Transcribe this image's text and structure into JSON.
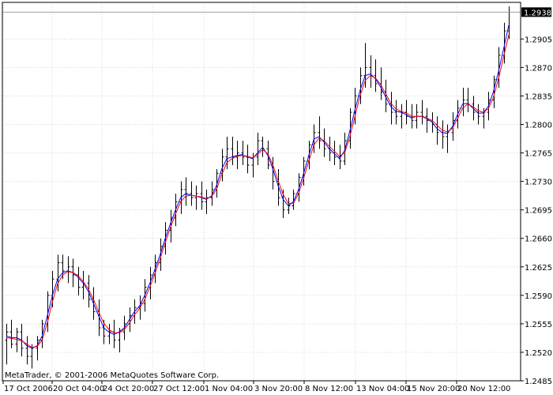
{
  "app": {
    "copyright": "MetaTrader, © 2001-2006 MetaQuotes Software Corp."
  },
  "colors": {
    "background": "#ffffff",
    "grid": "#d8d8d8",
    "frame": "#000000",
    "bars": "#000000",
    "ma_fast": "#ff0000",
    "ma_slow": "#0000ff",
    "price_line": "#a0a0a0"
  },
  "chart_data": {
    "type": "ohlc",
    "title": "",
    "ylim": [
      1.2485,
      1.295
    ],
    "grid": true,
    "y_ticks": [
      "1.2905",
      "1.2870",
      "1.2835",
      "1.2800",
      "1.2765",
      "1.2730",
      "1.2695",
      "1.2660",
      "1.2625",
      "1.2590",
      "1.2555",
      "1.2520",
      "1.2485"
    ],
    "x_ticks": [
      "17 Oct 2006",
      "20 Oct 04:00",
      "24 Oct 20:00",
      "27 Oct 12:00",
      "1 Nov 04:00",
      "3 Nov 20:00",
      "8 Nov 12:00",
      "13 Nov 04:00",
      "15 Nov 20:00",
      "20 Nov 12:00"
    ],
    "current_price": "1.2938",
    "series": [
      {
        "kind": "bars",
        "values": [
          [
            1.2535,
            1.2555,
            1.2505,
            1.2545
          ],
          [
            1.2545,
            1.256,
            1.2525,
            1.253
          ],
          [
            1.253,
            1.255,
            1.252,
            1.2545
          ],
          [
            1.2545,
            1.2555,
            1.2515,
            1.2525
          ],
          [
            1.2525,
            1.254,
            1.2505,
            1.2515
          ],
          [
            1.2515,
            1.253,
            1.25,
            1.2525
          ],
          [
            1.2525,
            1.254,
            1.251,
            1.2535
          ],
          [
            1.2535,
            1.256,
            1.2525,
            1.2555
          ],
          [
            1.2555,
            1.2595,
            1.2545,
            1.259
          ],
          [
            1.259,
            1.262,
            1.2575,
            1.261
          ],
          [
            1.261,
            1.264,
            1.2595,
            1.263
          ],
          [
            1.263,
            1.264,
            1.261,
            1.262
          ],
          [
            1.262,
            1.2638,
            1.2605,
            1.2625
          ],
          [
            1.2625,
            1.2635,
            1.26,
            1.2615
          ],
          [
            1.2615,
            1.2625,
            1.259,
            1.26
          ],
          [
            1.26,
            1.262,
            1.2585,
            1.2605
          ],
          [
            1.2605,
            1.2615,
            1.2575,
            1.2585
          ],
          [
            1.2585,
            1.26,
            1.256,
            1.257
          ],
          [
            1.257,
            1.2585,
            1.254,
            1.255
          ],
          [
            1.255,
            1.256,
            1.253,
            1.254
          ],
          [
            1.254,
            1.2555,
            1.253,
            1.2545
          ],
          [
            1.2545,
            1.256,
            1.2525,
            1.2535
          ],
          [
            1.2535,
            1.255,
            1.252,
            1.2545
          ],
          [
            1.2545,
            1.2565,
            1.2535,
            1.2555
          ],
          [
            1.2555,
            1.2575,
            1.2545,
            1.2565
          ],
          [
            1.2565,
            1.2585,
            1.2555,
            1.2575
          ],
          [
            1.2575,
            1.259,
            1.256,
            1.258
          ],
          [
            1.258,
            1.261,
            1.257,
            1.26
          ],
          [
            1.26,
            1.2625,
            1.2585,
            1.2615
          ],
          [
            1.2615,
            1.264,
            1.2605,
            1.263
          ],
          [
            1.263,
            1.266,
            1.262,
            1.265
          ],
          [
            1.265,
            1.268,
            1.264,
            1.267
          ],
          [
            1.267,
            1.2695,
            1.2655,
            1.2685
          ],
          [
            1.2685,
            1.2715,
            1.2675,
            1.2705
          ],
          [
            1.2705,
            1.273,
            1.269,
            1.272
          ],
          [
            1.272,
            1.2735,
            1.27,
            1.2715
          ],
          [
            1.2715,
            1.273,
            1.27,
            1.271
          ],
          [
            1.271,
            1.2725,
            1.2695,
            1.2715
          ],
          [
            1.2715,
            1.273,
            1.2695,
            1.2705
          ],
          [
            1.2705,
            1.272,
            1.269,
            1.271
          ],
          [
            1.271,
            1.273,
            1.27,
            1.272
          ],
          [
            1.272,
            1.2745,
            1.271,
            1.274
          ],
          [
            1.274,
            1.277,
            1.273,
            1.276
          ],
          [
            1.276,
            1.2785,
            1.2745,
            1.277
          ],
          [
            1.277,
            1.2785,
            1.275,
            1.276
          ],
          [
            1.276,
            1.278,
            1.2745,
            1.2765
          ],
          [
            1.2765,
            1.278,
            1.275,
            1.276
          ],
          [
            1.276,
            1.2775,
            1.274,
            1.275
          ],
          [
            1.275,
            1.2765,
            1.2735,
            1.276
          ],
          [
            1.276,
            1.279,
            1.275,
            1.278
          ],
          [
            1.278,
            1.2785,
            1.276,
            1.277
          ],
          [
            1.277,
            1.278,
            1.2745,
            1.275
          ],
          [
            1.275,
            1.276,
            1.272,
            1.273
          ],
          [
            1.273,
            1.2745,
            1.27,
            1.271
          ],
          [
            1.271,
            1.272,
            1.2685,
            1.2695
          ],
          [
            1.2695,
            1.271,
            1.269,
            1.27
          ],
          [
            1.27,
            1.272,
            1.2695,
            1.2715
          ],
          [
            1.2715,
            1.274,
            1.2705,
            1.2735
          ],
          [
            1.2735,
            1.276,
            1.2725,
            1.2755
          ],
          [
            1.2755,
            1.278,
            1.2745,
            1.2775
          ],
          [
            1.2775,
            1.28,
            1.2765,
            1.279
          ],
          [
            1.279,
            1.281,
            1.277,
            1.278
          ],
          [
            1.278,
            1.2795,
            1.276,
            1.277
          ],
          [
            1.277,
            1.2785,
            1.2755,
            1.2765
          ],
          [
            1.2765,
            1.278,
            1.275,
            1.276
          ],
          [
            1.276,
            1.2775,
            1.2745,
            1.2755
          ],
          [
            1.2755,
            1.279,
            1.275,
            1.278
          ],
          [
            1.278,
            1.282,
            1.277,
            1.2815
          ],
          [
            1.2815,
            1.2845,
            1.28,
            1.2835
          ],
          [
            1.2835,
            1.287,
            1.2825,
            1.286
          ],
          [
            1.286,
            1.29,
            1.2845,
            1.287
          ],
          [
            1.287,
            1.2885,
            1.2845,
            1.286
          ],
          [
            1.286,
            1.288,
            1.284,
            1.285
          ],
          [
            1.285,
            1.287,
            1.283,
            1.284
          ],
          [
            1.284,
            1.2855,
            1.2815,
            1.2825
          ],
          [
            1.2825,
            1.284,
            1.28,
            1.2815
          ],
          [
            1.2815,
            1.283,
            1.28,
            1.281
          ],
          [
            1.281,
            1.2825,
            1.2795,
            1.2815
          ],
          [
            1.2815,
            1.283,
            1.28,
            1.281
          ],
          [
            1.281,
            1.2825,
            1.2795,
            1.2805
          ],
          [
            1.2805,
            1.2825,
            1.2795,
            1.2815
          ],
          [
            1.2815,
            1.283,
            1.28,
            1.281
          ],
          [
            1.281,
            1.282,
            1.279,
            1.2805
          ],
          [
            1.2805,
            1.2815,
            1.279,
            1.28
          ],
          [
            1.28,
            1.281,
            1.2775,
            1.279
          ],
          [
            1.279,
            1.2805,
            1.277,
            1.2785
          ],
          [
            1.2785,
            1.28,
            1.2765,
            1.279
          ],
          [
            1.279,
            1.2815,
            1.278,
            1.2805
          ],
          [
            1.2805,
            1.283,
            1.2795,
            1.282
          ],
          [
            1.282,
            1.2845,
            1.281,
            1.283
          ],
          [
            1.283,
            1.2845,
            1.2815,
            1.2825
          ],
          [
            1.2825,
            1.2835,
            1.2805,
            1.2815
          ],
          [
            1.2815,
            1.2825,
            1.28,
            1.281
          ],
          [
            1.281,
            1.282,
            1.2795,
            1.2815
          ],
          [
            1.2815,
            1.284,
            1.2805,
            1.283
          ],
          [
            1.283,
            1.286,
            1.282,
            1.2855
          ],
          [
            1.2855,
            1.2895,
            1.2845,
            1.2885
          ],
          [
            1.2885,
            1.2925,
            1.2875,
            1.2915
          ],
          [
            1.2915,
            1.2945,
            1.2905,
            1.2938
          ]
        ]
      },
      {
        "kind": "ma",
        "values": [
          1.254,
          1.2538,
          1.2538,
          1.2535,
          1.2528,
          1.2525,
          1.2528,
          1.254,
          1.2565,
          1.259,
          1.261,
          1.2618,
          1.262,
          1.2618,
          1.2612,
          1.2605,
          1.2595,
          1.258,
          1.2565,
          1.255,
          1.2545,
          1.2542,
          1.2545,
          1.255,
          1.256,
          1.257,
          1.2577,
          1.259,
          1.2605,
          1.2622,
          1.264,
          1.266,
          1.2678,
          1.2695,
          1.271,
          1.2715,
          1.2713,
          1.2712,
          1.271,
          1.2708,
          1.2712,
          1.2725,
          1.2745,
          1.2758,
          1.276,
          1.2762,
          1.2763,
          1.276,
          1.2758,
          1.2765,
          1.2772,
          1.2762,
          1.2745,
          1.2725,
          1.2708,
          1.27,
          1.2705,
          1.272,
          1.274,
          1.2762,
          1.2782,
          1.2785,
          1.2778,
          1.277,
          1.2764,
          1.2758,
          1.2768,
          1.2792,
          1.2818,
          1.2842,
          1.286,
          1.2862,
          1.2856,
          1.2846,
          1.2834,
          1.2822,
          1.2816,
          1.2815,
          1.2812,
          1.2808,
          1.281,
          1.281,
          1.2807,
          1.2803,
          1.2795,
          1.279,
          1.2789,
          1.2797,
          1.2812,
          1.2825,
          1.2826,
          1.282,
          1.2814,
          1.2814,
          1.2822,
          1.284,
          1.2865,
          1.2893,
          1.2922
        ]
      },
      {
        "kind": "ma",
        "values": [
          1.2538,
          1.2537,
          1.2536,
          1.2534,
          1.253,
          1.2526,
          1.2527,
          1.2535,
          1.2556,
          1.2582,
          1.2604,
          1.2615,
          1.2619,
          1.2618,
          1.2614,
          1.2607,
          1.2598,
          1.2585,
          1.257,
          1.2556,
          1.2548,
          1.2544,
          1.2544,
          1.2548,
          1.2556,
          1.2566,
          1.2574,
          1.2585,
          1.26,
          1.2617,
          1.2635,
          1.2655,
          1.2673,
          1.269,
          1.2705,
          1.2712,
          1.2713,
          1.2712,
          1.2711,
          1.2709,
          1.2711,
          1.272,
          1.2738,
          1.2753,
          1.2758,
          1.2761,
          1.2762,
          1.2761,
          1.2759,
          1.2763,
          1.2769,
          1.2764,
          1.275,
          1.2731,
          1.2714,
          1.2703,
          1.2703,
          1.2715,
          1.2734,
          1.2755,
          1.2775,
          1.2783,
          1.278,
          1.2773,
          1.2767,
          1.2761,
          1.2765,
          1.2785,
          1.281,
          1.2835,
          1.2854,
          1.286,
          1.2857,
          1.2849,
          1.2838,
          1.2826,
          1.2819,
          1.2816,
          1.2814,
          1.281,
          1.281,
          1.281,
          1.2808,
          1.2805,
          1.2799,
          1.2793,
          1.2791,
          1.2795,
          1.2807,
          1.282,
          1.2825,
          1.2822,
          1.2817,
          1.2815,
          1.2819,
          1.2833,
          1.2856,
          1.2883,
          1.291
        ]
      }
    ]
  }
}
